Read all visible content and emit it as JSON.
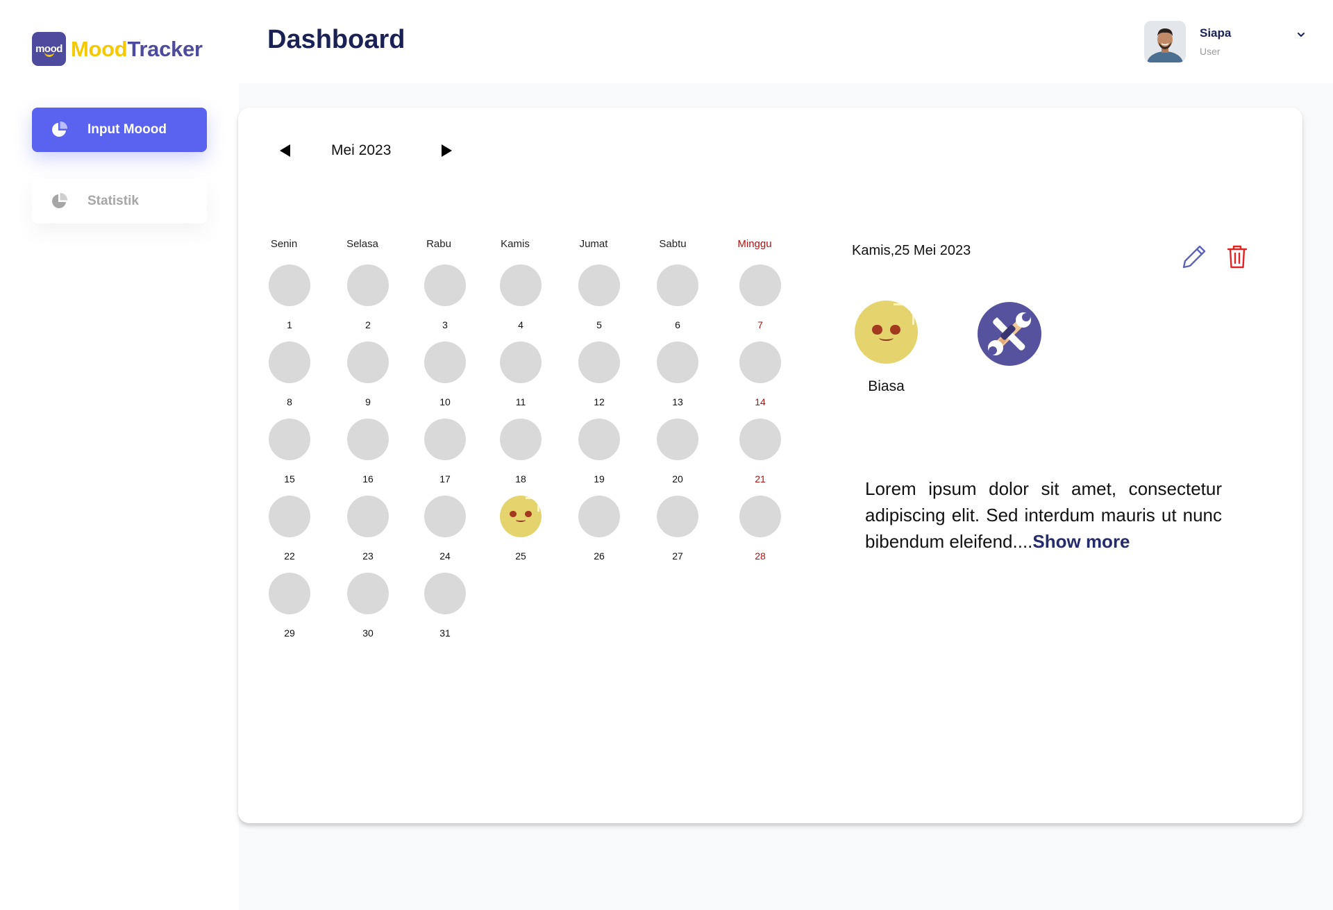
{
  "brand": {
    "logo_mark": "mood",
    "name_part1": "Mood",
    "name_part2": "Tracker"
  },
  "sidebar": {
    "items": [
      {
        "label": "Input Moood",
        "icon": "pie-chart-icon",
        "active": true
      },
      {
        "label": "Statistik",
        "icon": "pie-chart-icon",
        "active": false
      }
    ]
  },
  "header": {
    "title": "Dashboard",
    "user": {
      "name": "Siapa",
      "role": "User"
    }
  },
  "calendar": {
    "month_label": "Mei 2023",
    "weekdays": [
      "Senin",
      "Selasa",
      "Rabu",
      "Kamis",
      "Jumat",
      "Sabtu",
      "Minggu"
    ],
    "days": [
      "1",
      "2",
      "3",
      "4",
      "5",
      "6",
      "7",
      "8",
      "9",
      "10",
      "11",
      "12",
      "13",
      "14",
      "15",
      "16",
      "17",
      "18",
      "19",
      "20",
      "21",
      "22",
      "23",
      "24",
      "25",
      "26",
      "27",
      "28",
      "29",
      "30",
      "31"
    ],
    "recorded_day": "25",
    "sunday_color": "#b01212"
  },
  "detail": {
    "date": "Kamis,25 Mei 2023",
    "mood_label": "Biasa",
    "activity_icon": "tools-icon",
    "note": "Lorem ipsum dolor sit amet, consectetur adipiscing elit. Sed interdum mauris ut nunc bibendum eleifend....",
    "show_more": "Show more"
  },
  "colors": {
    "accent": "#5a63ef",
    "brand_purple": "#4e4a9d",
    "brand_yellow": "#f5c900",
    "title_navy": "#1a2155",
    "mood_yellow": "#e5d46d",
    "delete_red": "#e02424"
  }
}
